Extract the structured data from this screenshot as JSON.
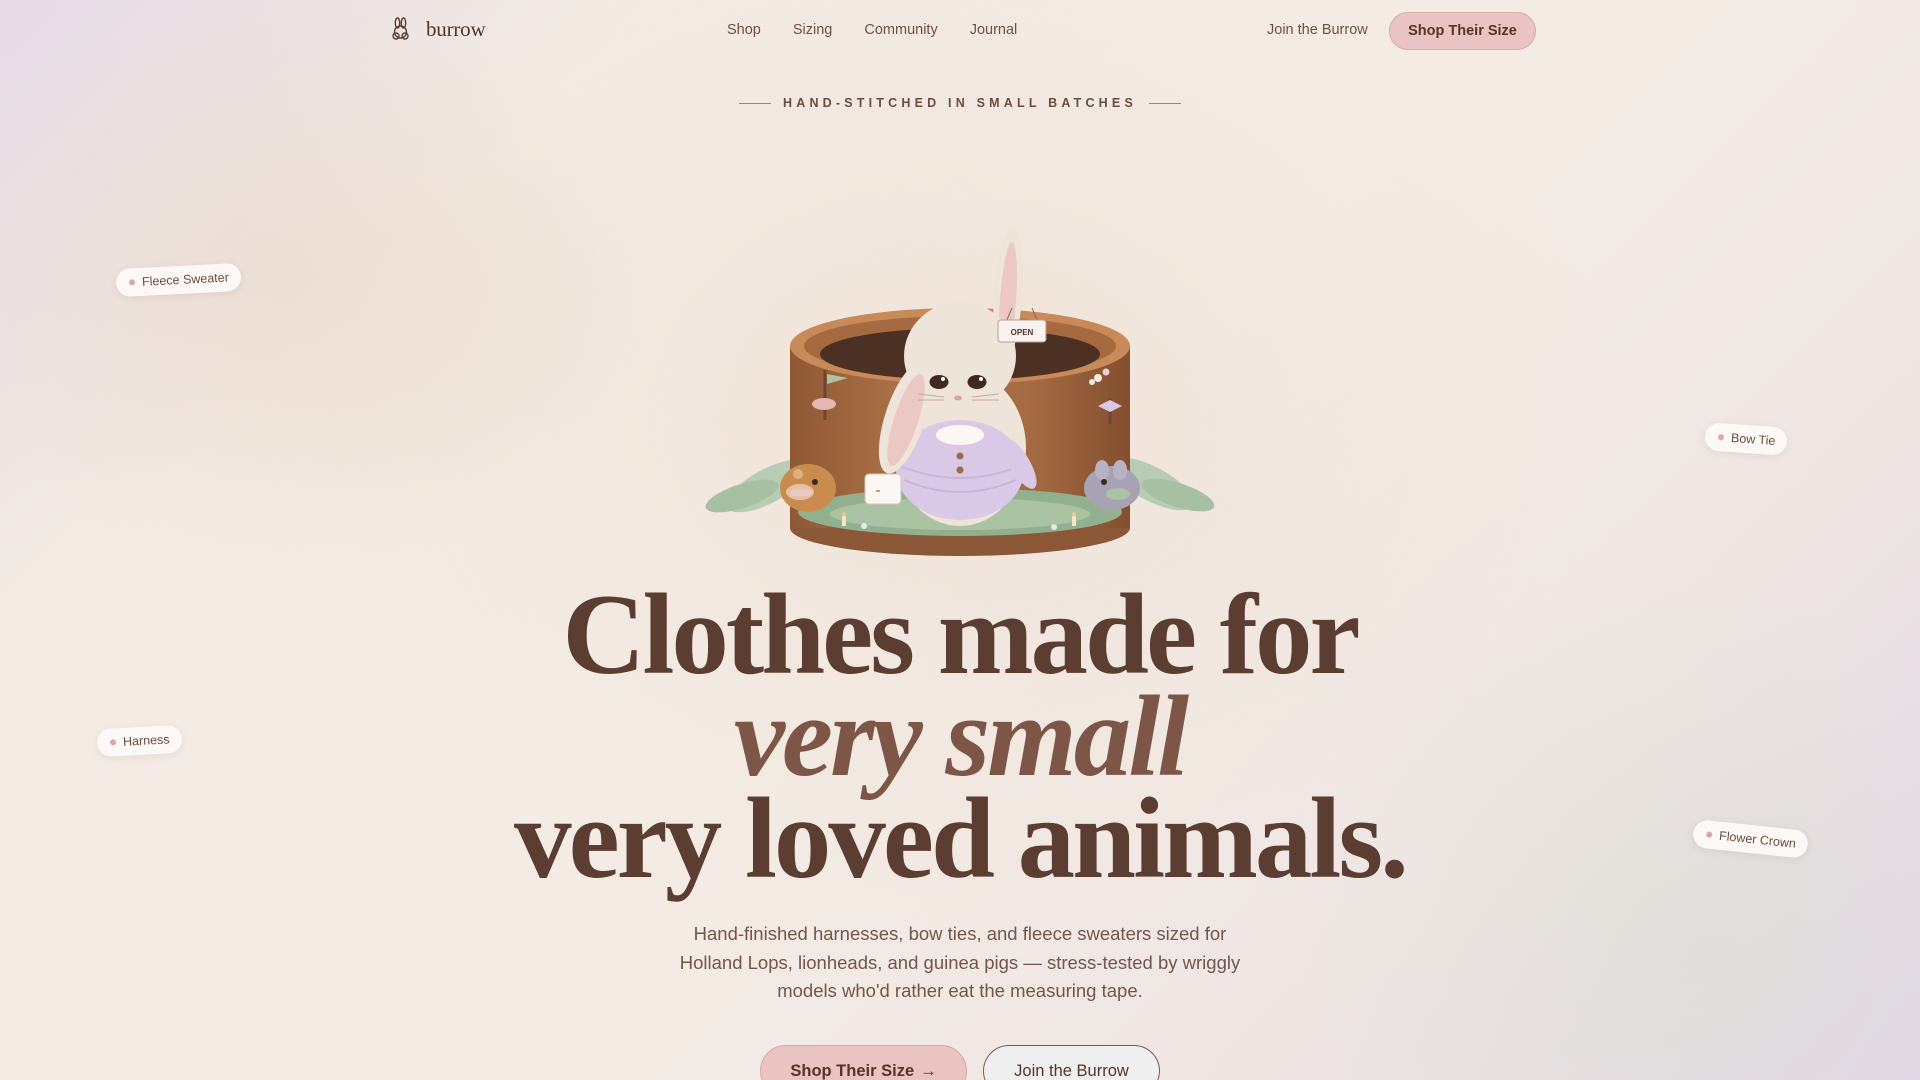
{
  "brand": {
    "name": "burrow",
    "logo_icon": "bunny-logo-icon"
  },
  "nav": {
    "links": [
      "Shop",
      "Sizing",
      "Community",
      "Journal"
    ],
    "join_label": "Join the Burrow",
    "cta_label": "Shop Their Size"
  },
  "hero": {
    "eyebrow": "HAND-STITCHED IN SMALL BATCHES",
    "sign_text": "OPEN",
    "headline_line1": "Clothes made for",
    "headline_line2": "very small",
    "headline_line3": "very loved animals.",
    "subtitle": "Hand-finished harnesses, bow ties, and fleece sweaters sized for Holland Lops, lionheads, and guinea pigs — stress-tested by wriggly models who'd rather eat the measuring tape.",
    "primary_cta": "Shop Their Size",
    "primary_cta_arrow": "→",
    "secondary_cta": "Join the Burrow"
  },
  "floating_tags": {
    "fleece": "Fleece Sweater",
    "bowtie": "Bow Tie",
    "harness": "Harness",
    "flower": "Flower Crown"
  },
  "colors": {
    "accent_pink": "#eac3c3",
    "text_brown": "#5b3d31",
    "lavender": "#d9c9e6",
    "basket": "#a96e47"
  }
}
